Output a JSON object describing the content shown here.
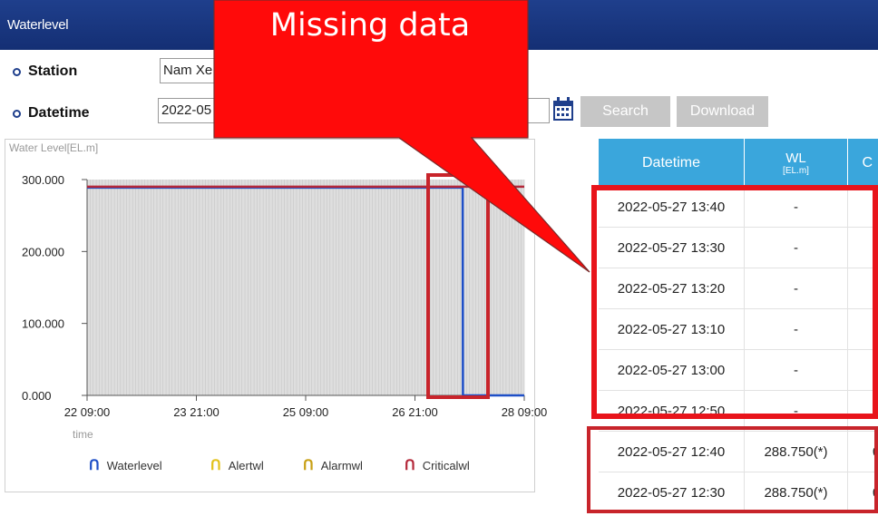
{
  "header": {
    "title": "Waterlevel"
  },
  "form": {
    "station_label": "Station",
    "station_value": "Nam Xe",
    "datetime_label": "Datetime",
    "datetime_value": "2022-05",
    "search_label": "Search",
    "download_label": "Download"
  },
  "callout": {
    "text": "Missing data"
  },
  "table": {
    "headers": {
      "datetime": "Datetime",
      "wl": "WL",
      "wl_unit": "[EL.m]",
      "partial": "C"
    },
    "rows": [
      {
        "datetime": "2022-05-27 13:40",
        "wl": "-",
        "extra": ""
      },
      {
        "datetime": "2022-05-27 13:30",
        "wl": "-",
        "extra": ""
      },
      {
        "datetime": "2022-05-27 13:20",
        "wl": "-",
        "extra": ""
      },
      {
        "datetime": "2022-05-27 13:10",
        "wl": "-",
        "extra": ""
      },
      {
        "datetime": "2022-05-27 13:00",
        "wl": "-",
        "extra": ""
      },
      {
        "datetime": "2022-05-27 12:50",
        "wl": "-",
        "extra": ""
      },
      {
        "datetime": "2022-05-27 12:40",
        "wl": "288.750(*)",
        "extra": "0"
      },
      {
        "datetime": "2022-05-27 12:30",
        "wl": "288.750(*)",
        "extra": "0"
      }
    ]
  },
  "chart_data": {
    "type": "line",
    "ylabel": "Water Level[EL.m]",
    "xlabel": "time",
    "ylim": [
      0,
      300
    ],
    "yticks": [
      "300.000",
      "200.000",
      "100.000",
      "0.000"
    ],
    "ytick_values": [
      300,
      200,
      100,
      0
    ],
    "xticks": [
      "22 09:00",
      "23 21:00",
      "25 09:00",
      "26 21:00",
      "28 09:00"
    ],
    "x_hours": [
      0,
      36,
      72,
      108,
      144
    ],
    "grid": true,
    "legend_position": "bottom",
    "series": [
      {
        "name": "Waterlevel",
        "color": "#1e4fc7",
        "points": [
          [
            0,
            288.75
          ],
          [
            123.7,
            288.75
          ],
          [
            123.8,
            0
          ],
          [
            144,
            0
          ]
        ]
      },
      {
        "name": "Alertwl",
        "color": "#e3c21c",
        "points": []
      },
      {
        "name": "Alarmwl",
        "color": "#c8a015",
        "points": []
      },
      {
        "name": "Criticalwl",
        "color": "#b4283a",
        "points": [
          [
            0,
            290
          ],
          [
            144,
            290
          ]
        ]
      }
    ]
  },
  "colors": {
    "header_bg": "#1f3f8c",
    "table_head": "#3aa6dc",
    "highlight_red": "#e8141b"
  }
}
